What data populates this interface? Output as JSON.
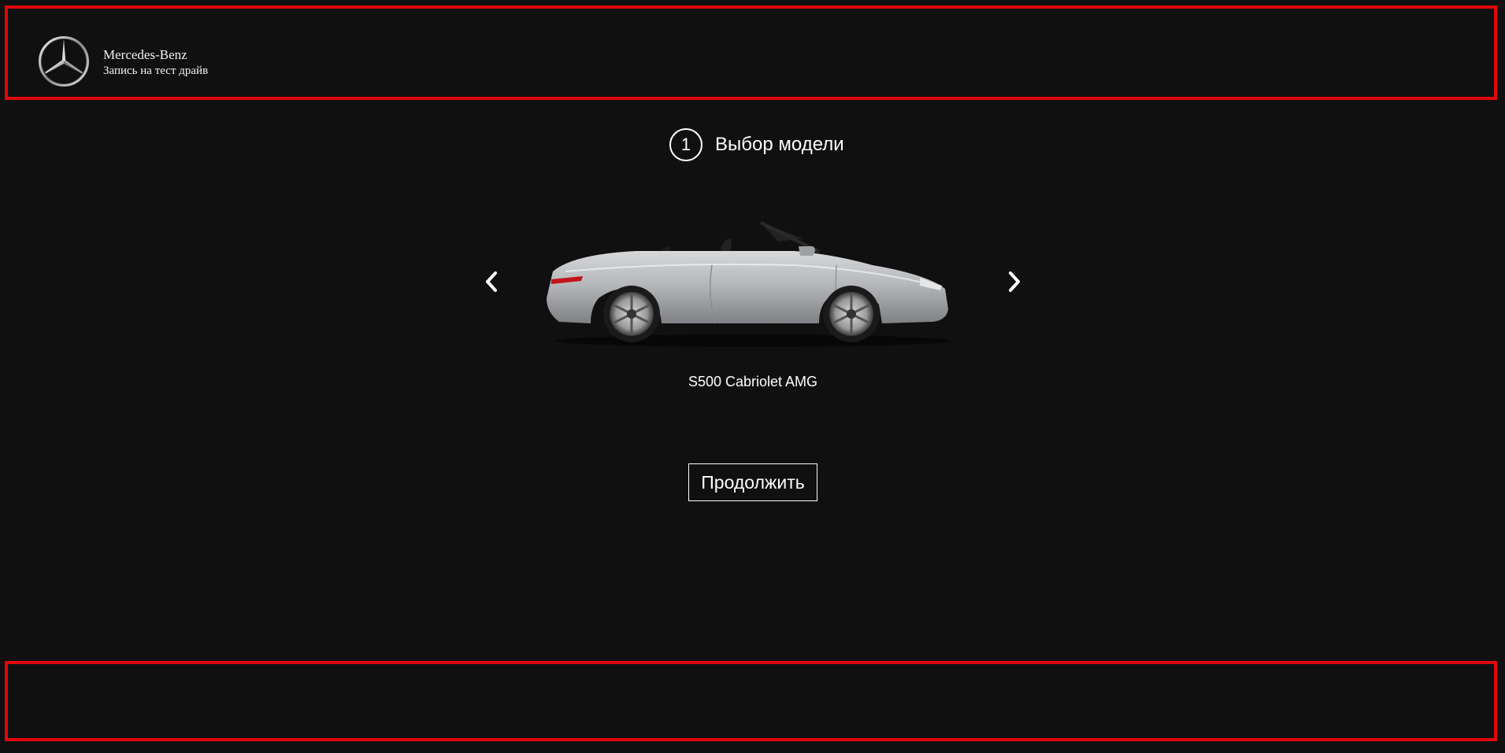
{
  "header": {
    "brand_name": "Mercedes-Benz",
    "subtitle": "Запись на тест драйв",
    "logo_icon": "mercedes-star-logo",
    "frame_color": "#e1070b"
  },
  "step": {
    "number": "1",
    "title": "Выбор модели"
  },
  "carousel": {
    "prev_icon": "chevron-left-icon",
    "next_icon": "chevron-right-icon",
    "current_model": "S500 Cabriolet AMG",
    "car_color": "#b9babd"
  },
  "actions": {
    "continue_label": "Продолжить"
  },
  "footer": {
    "frame_color": "#e1070b"
  },
  "colors": {
    "background": "#101010",
    "text": "#ffffff"
  }
}
